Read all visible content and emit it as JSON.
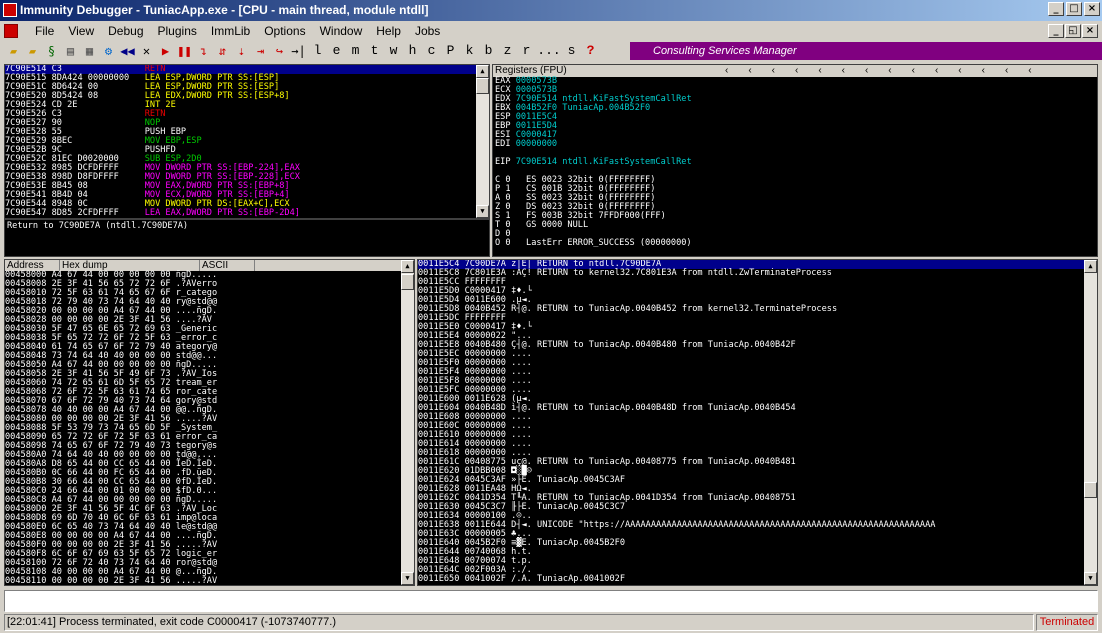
{
  "window": {
    "title": "Immunity Debugger - TuniacApp.exe - [CPU - main thread, module ntdll]"
  },
  "menu": [
    "File",
    "View",
    "Debug",
    "Plugins",
    "ImmLib",
    "Options",
    "Window",
    "Help",
    "Jobs"
  ],
  "toolbar": {
    "letters": [
      "l",
      "e",
      "m",
      "t",
      "w",
      "h",
      "c",
      "P",
      "k",
      "b",
      "z",
      "r",
      "...",
      "s",
      "?"
    ],
    "banner": "Consulting Services Manager"
  },
  "disasm": {
    "rows": [
      {
        "addr": "7C90E514",
        "hex": "C3",
        "asm": "RETN",
        "cls": "c-r",
        "sel": true
      },
      {
        "addr": "7C90E515",
        "hex": "8DA424 00000000",
        "asm": "LEA ESP,DWORD PTR SS:[ESP]",
        "cls": "c-y"
      },
      {
        "addr": "7C90E51C",
        "hex": "8D6424 00",
        "asm": "LEA ESP,DWORD PTR SS:[ESP]",
        "cls": "c-y"
      },
      {
        "addr": "7C90E520",
        "hex": "8D5424 08",
        "asm": "LEA EDX,DWORD PTR SS:[ESP+8]",
        "cls": "c-y"
      },
      {
        "addr": "7C90E524",
        "hex": "CD 2E",
        "asm": "INT 2E",
        "cls": "c-y"
      },
      {
        "addr": "7C90E526",
        "hex": "C3",
        "asm": "RETN",
        "cls": "c-r"
      },
      {
        "addr": "7C90E527",
        "hex": "90",
        "asm": "NOP",
        "cls": "c-g"
      },
      {
        "addr": "7C90E528",
        "hex": "55",
        "asm": "PUSH EBP",
        "cls": ""
      },
      {
        "addr": "7C90E529",
        "hex": "8BEC",
        "asm": "MOV EBP,ESP",
        "cls": "c-g"
      },
      {
        "addr": "7C90E52B",
        "hex": "9C",
        "asm": "PUSHFD",
        "cls": ""
      },
      {
        "addr": "7C90E52C",
        "hex": "81EC D0020000",
        "asm": "SUB ESP,2D0",
        "cls": "c-g"
      },
      {
        "addr": "7C90E532",
        "hex": "8985 DCFDFFFF",
        "asm": "MOV DWORD PTR SS:[EBP-224],EAX",
        "cls": "c-m"
      },
      {
        "addr": "7C90E538",
        "hex": "898D D8FDFFFF",
        "asm": "MOV DWORD PTR SS:[EBP-228],ECX",
        "cls": "c-m"
      },
      {
        "addr": "7C90E53E",
        "hex": "8B45 08",
        "asm": "MOV EAX,DWORD PTR SS:[EBP+8]",
        "cls": "c-m"
      },
      {
        "addr": "7C90E541",
        "hex": "8B4D 04",
        "asm": "MOV ECX,DWORD PTR SS:[EBP+4]",
        "cls": "c-m"
      },
      {
        "addr": "7C90E544",
        "hex": "8948 0C",
        "asm": "MOV DWORD PTR DS:[EAX+C],ECX",
        "cls": "c-y"
      },
      {
        "addr": "7C90E547",
        "hex": "8D85 2CFDFFFF",
        "asm": "LEA EAX,DWORD PTR SS:[EBP-2D4]",
        "cls": "c-m"
      }
    ],
    "info": "Return to 7C90DE7A (ntdll.7C90DE7A)"
  },
  "registers": {
    "header": "Registers (FPU)",
    "lines": [
      "EAX 0000573B",
      "ECX 0000573B",
      "EDX 7C90E514 ntdll.KiFastSystemCallRet",
      "EBX 004B52F0 TuniacAp.004B52F0",
      "ESP 0011E5C4",
      "EBP 0011E5D4",
      "ESI C0000417",
      "EDI 00000000",
      "",
      "EIP 7C90E514 ntdll.KiFastSystemCallRet",
      "",
      "C 0   ES 0023 32bit 0(FFFFFFFF)",
      "P 1   CS 001B 32bit 0(FFFFFFFF)",
      "A 0   SS 0023 32bit 0(FFFFFFFF)",
      "Z 0   DS 0023 32bit 0(FFFFFFFF)",
      "S 1   FS 003B 32bit 7FFDF000(FFF)",
      "T 0   GS 0000 NULL",
      "D 0",
      "O 0   LastErr ERROR_SUCCESS (00000000)",
      "",
      "EFL 00200286 (NO,NB,NE,A,S,PE,L,LE)"
    ]
  },
  "dump": {
    "col_address": "Address",
    "col_hex": "Hex dump",
    "col_ascii": "ASCII",
    "rows": [
      [
        "00458000",
        "A4 67 44 00 00 00 00 00",
        "ñgD....."
      ],
      [
        "00458008",
        "2E 3F 41 56 65 72 72 6F",
        ".?AVerro"
      ],
      [
        "00458010",
        "72 5F 63 61 74 65 67 6F",
        "r_catego"
      ],
      [
        "00458018",
        "72 79 40 73 74 64 40 40",
        "ry@std@@"
      ],
      [
        "00458020",
        "00 00 00 00 A4 67 44 00",
        "....ñgD."
      ],
      [
        "00458028",
        "00 00 00 00 2E 3F 41 56",
        "....?AV"
      ],
      [
        "00458030",
        "5F 47 65 6E 65 72 69 63",
        "_Generic"
      ],
      [
        "00458038",
        "5F 65 72 72 6F 72 5F 63",
        "_error_c"
      ],
      [
        "00458040",
        "61 74 65 67 6F 72 79 40",
        "ategory@"
      ],
      [
        "00458048",
        "73 74 64 40 40 00 00 00",
        "std@@..."
      ],
      [
        "00458050",
        "A4 67 44 00 00 00 00 00",
        "ñgD....."
      ],
      [
        "00458058",
        "2E 3F 41 56 5F 49 6F 73",
        ".?AV_Ios"
      ],
      [
        "00458060",
        "74 72 65 61 6D 5F 65 72",
        "tream_er"
      ],
      [
        "00458068",
        "72 6F 72 5F 63 61 74 65",
        "ror_cate"
      ],
      [
        "00458070",
        "67 6F 72 79 40 73 74 64",
        "gory@std"
      ],
      [
        "00458078",
        "40 40 00 00 A4 67 44 00",
        "@@..ñgD."
      ],
      [
        "00458080",
        "00 00 00 00 2E 3F 41 56",
        ".....?AV"
      ],
      [
        "00458088",
        "5F 53 79 73 74 65 6D 5F",
        "_System_"
      ],
      [
        "00458090",
        "65 72 72 6F 72 5F 63 61",
        "error_ca"
      ],
      [
        "00458098",
        "74 65 67 6F 72 79 40 73",
        "tegory@s"
      ],
      [
        "004580A0",
        "74 64 40 40 00 00 00 00",
        "td@@...."
      ],
      [
        "004580A8",
        "D8 65 44 00 CC 65 44 00",
        "ÏeD.ÌeD."
      ],
      [
        "004580B0",
        "0C 66 44 00 FC 65 44 00",
        ".fD.üeD."
      ],
      [
        "004580B8",
        "30 66 44 00 CC 65 44 00",
        "0fD.ÌeD."
      ],
      [
        "004580C0",
        "24 66 44 00 01 00 00 00",
        "$fD.0..."
      ],
      [
        "004580C8",
        "A4 67 44 00 00 00 00 00",
        "ñgD....."
      ],
      [
        "004580D0",
        "2E 3F 41 56 5F 4C 6F 63",
        ".?AV_Loc"
      ],
      [
        "004580D8",
        "69 6D 70 40 6C 6F 63 61",
        "imp@loca"
      ],
      [
        "004580E0",
        "6C 65 40 73 74 64 40 40",
        "le@std@@"
      ],
      [
        "004580E8",
        "00 00 00 00 A4 67 44 00",
        "....ñgD."
      ],
      [
        "004580F0",
        "00 00 00 00 2E 3F 41 56",
        ".....?AV"
      ],
      [
        "004580F8",
        "6C 6F 67 69 63 5F 65 72",
        "logic_er"
      ],
      [
        "00458100",
        "72 6F 72 40 73 74 64 40",
        "ror@std@"
      ],
      [
        "00458108",
        "40 00 00 00 A4 67 44 00",
        "@...ñgD."
      ],
      [
        "00458110",
        "00 00 00 00 2E 3F 41 56",
        ".....?AV"
      ]
    ]
  },
  "stack": {
    "rows": [
      [
        "0011E5C4",
        "7C90DE7A",
        "z|E|",
        "RETURN to ntdll.7C90DE7A"
      ],
      [
        "0011E5C8",
        "7C801E3A",
        ":AÇ!",
        "RETURN to kernel32.7C801E3A from ntdll.ZwTerminateProcess"
      ],
      [
        "0011E5CC",
        "FFFFFFFF",
        "",
        ""
      ],
      [
        "0011E5D0",
        "C0000417",
        "‡♦.└",
        ""
      ],
      [
        "0011E5D4",
        "0011E600",
        ".µ◄.",
        ""
      ],
      [
        "0011E5D8",
        "0040B452",
        "R┤@.",
        "RETURN to TuniacAp.0040B452 from kernel32.TerminateProcess"
      ],
      [
        "0011E5DC",
        "FFFFFFFF",
        "",
        ""
      ],
      [
        "0011E5E0",
        "C0000417",
        "‡♦.└",
        ""
      ],
      [
        "0011E5E4",
        "00000022",
        "\"...",
        ""
      ],
      [
        "0011E5E8",
        "0040B480",
        "Ç┤@.",
        "RETURN to TuniacAp.0040B480 from TuniacAp.0040B42F"
      ],
      [
        "0011E5EC",
        "00000000",
        "....",
        ""
      ],
      [
        "0011E5F0",
        "00000000",
        "....",
        ""
      ],
      [
        "0011E5F4",
        "00000000",
        "....",
        ""
      ],
      [
        "0011E5F8",
        "00000000",
        "....",
        ""
      ],
      [
        "0011E5FC",
        "00000000",
        "....",
        ""
      ],
      [
        "0011E600",
        "0011E628",
        "(µ◄.",
        ""
      ],
      [
        "0011E604",
        "0040B48D",
        "ì┤@.",
        "RETURN to TuniacAp.0040B48D from TuniacAp.0040B454"
      ],
      [
        "0011E608",
        "00000000",
        "....",
        ""
      ],
      [
        "0011E60C",
        "00000000",
        "....",
        ""
      ],
      [
        "0011E610",
        "00000000",
        "....",
        ""
      ],
      [
        "0011E614",
        "00000000",
        "....",
        ""
      ],
      [
        "0011E618",
        "00000000",
        "....",
        ""
      ],
      [
        "0011E61C",
        "00408775",
        "uç@.",
        "RETURN to TuniacAp.00408775 from TuniacAp.0040B481"
      ],
      [
        "0011E620",
        "01DBB008",
        "◘░█☺",
        ""
      ],
      [
        "0011E624",
        "0045C3AF",
        "»├E.",
        "TuniacAp.0045C3AF"
      ],
      [
        "0011E628",
        "0011EA48",
        "HΩ◄.",
        ""
      ],
      [
        "0011E62C",
        "0041D354",
        "T╙A.",
        "RETURN to TuniacAp.0041D354 from TuniacAp.00408751"
      ],
      [
        "0011E630",
        "0045C3C7",
        "╟├E.",
        "TuniacAp.0045C3C7"
      ],
      [
        "0011E634",
        "00000100",
        ".☺..",
        ""
      ],
      [
        "0011E638",
        "0011E644",
        "D┤◄.",
        "UNICODE \"https://AAAAAAAAAAAAAAAAAAAAAAAAAAAAAAAAAAAAAAAAAAAAAAAAAAAAAAAAAAAA"
      ],
      [
        "0011E63C",
        "00000005",
        "♣...",
        ""
      ],
      [
        "0011E640",
        "0045B2F0",
        "≡▓E.",
        "TuniacAp.0045B2F0"
      ],
      [
        "0011E644",
        "00740068",
        "h.t.",
        ""
      ],
      [
        "0011E648",
        "00700074",
        "t.p.",
        ""
      ],
      [
        "0011E64C",
        "002F003A",
        ":./.",
        ""
      ],
      [
        "0011E650",
        "0041002F",
        "/.A.",
        "TuniacAp.0041002F"
      ]
    ]
  },
  "status": {
    "text": "[22:01:41] Process terminated, exit code C0000417 (-1073740777.)",
    "state": "Terminated"
  },
  "colors": {
    "title": "#0a246a",
    "banner": "#800080",
    "selection": "#00008b",
    "terminated": "#cc0000"
  }
}
